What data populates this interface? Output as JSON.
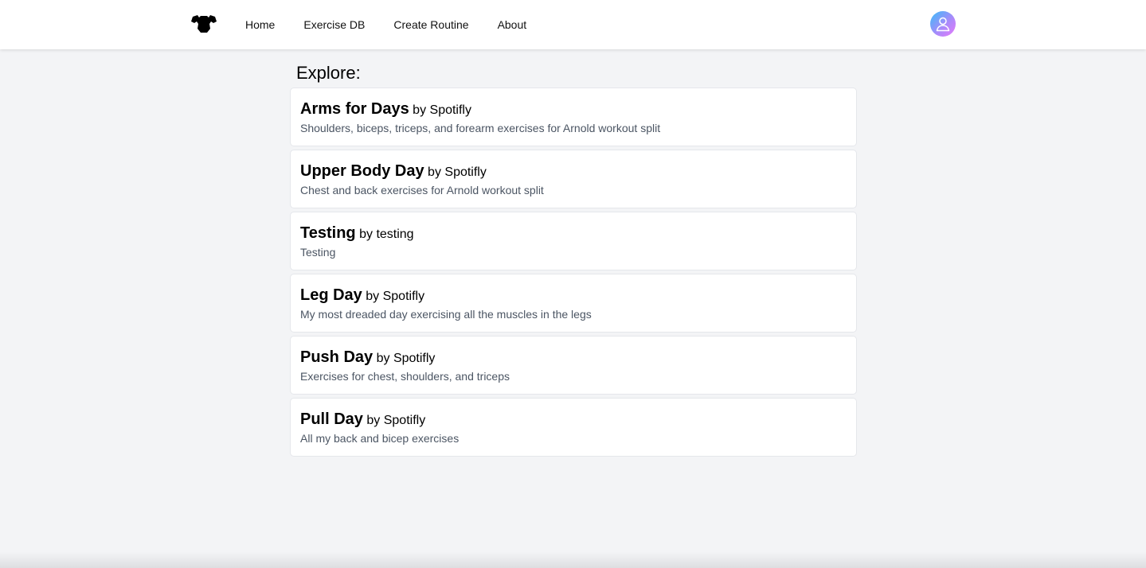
{
  "nav": {
    "logo_icon": "flexing-muscles-icon",
    "links": [
      {
        "label": "Home"
      },
      {
        "label": "Exercise DB"
      },
      {
        "label": "Create Routine"
      },
      {
        "label": "About"
      }
    ],
    "avatar_icon": "user-icon"
  },
  "main": {
    "heading": "Explore:",
    "routines": [
      {
        "title": "Arms for Days",
        "author": "by Spotifly",
        "description": "Shoulders, biceps, triceps, and forearm exercises for Arnold workout split"
      },
      {
        "title": "Upper Body Day",
        "author": "by Spotifly",
        "description": "Chest and back exercises for Arnold workout split"
      },
      {
        "title": "Testing",
        "author": "by testing",
        "description": "Testing"
      },
      {
        "title": "Leg Day",
        "author": "by Spotifly",
        "description": "My most dreaded day exercising all the muscles in the legs"
      },
      {
        "title": "Push Day",
        "author": "by Spotifly",
        "description": "Exercises for chest, shoulders, and triceps"
      },
      {
        "title": "Pull Day",
        "author": "by Spotifly",
        "description": "All my back and bicep exercises"
      }
    ]
  },
  "colors": {
    "background": "#f3f4f6",
    "card": "#ffffff",
    "description_text": "#4b5563",
    "avatar_gradient": [
      "#38bdf8",
      "#a78bfa",
      "#e879f9"
    ]
  }
}
